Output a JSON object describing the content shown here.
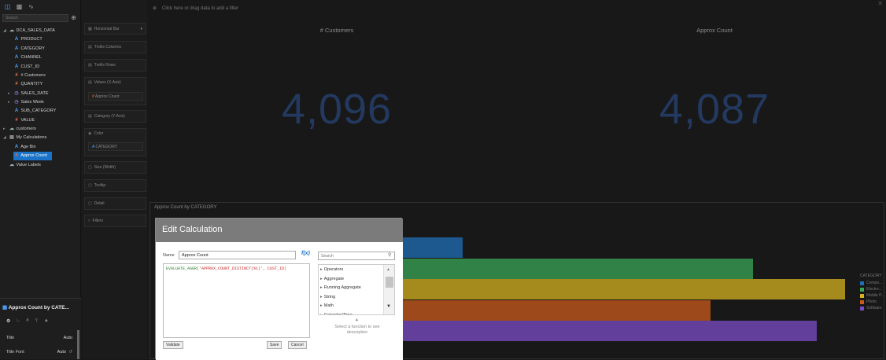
{
  "left_panel": {
    "tabs": [
      {
        "icon": "database-icon"
      },
      {
        "icon": "bar-chart-icon"
      },
      {
        "icon": "analytics-icon"
      }
    ],
    "search_placeholder": "Search",
    "tree": [
      {
        "label": "DCA_SALES_DATA",
        "type": "datasource",
        "expanded": true
      },
      {
        "label": "PRODUCT",
        "type": "attribute"
      },
      {
        "label": "CATEGORY",
        "type": "attribute"
      },
      {
        "label": "CHANNEL",
        "type": "attribute"
      },
      {
        "label": "CUST_ID",
        "type": "attribute"
      },
      {
        "label": "# Customers",
        "type": "measure"
      },
      {
        "label": "QUANTITY",
        "type": "measure"
      },
      {
        "label": "SALES_DATE",
        "type": "time"
      },
      {
        "label": "Sales Week",
        "type": "time"
      },
      {
        "label": "SUB_CATEGORY",
        "type": "attribute"
      },
      {
        "label": "VALUE",
        "type": "measure"
      },
      {
        "label": "customers",
        "type": "datasource"
      },
      {
        "label": "My Calculations",
        "type": "folder",
        "expanded": true
      },
      {
        "label": "Age Bin",
        "type": "attribute"
      },
      {
        "label": "Approx Count",
        "type": "measure",
        "selected": true
      },
      {
        "label": "Value Labels",
        "type": "datasource"
      }
    ]
  },
  "properties": {
    "title": "Approx Count by CATE...",
    "rows": [
      {
        "label": "Title",
        "value": "Auto"
      },
      {
        "label": "Title Font",
        "value": "Auto"
      }
    ]
  },
  "grammar": {
    "chart_type": "Horizontal Bar",
    "shelves": [
      {
        "label": "Trellis Columns"
      },
      {
        "label": "Trellis Rows"
      },
      {
        "label": "Values (X-Axis)"
      },
      {
        "label": "Approx Count"
      },
      {
        "label": "Category (Y-Axis)"
      },
      {
        "label": "Color"
      },
      {
        "label": "CATEGORY"
      },
      {
        "label": "Size (Width)"
      },
      {
        "label": "Tooltip"
      },
      {
        "label": "Detail"
      },
      {
        "label": "Filters"
      }
    ]
  },
  "canvas": {
    "filter_prompt": "Click here or drag data to add a filter",
    "tiles": [
      {
        "title": "# Customers",
        "value": "4,096"
      },
      {
        "title": "Approx Count",
        "value": "4,087"
      }
    ],
    "bar_chart_title": "Approx Count by CATEGORY",
    "legend_title": "CATEGORY",
    "legend": [
      {
        "label": "Compo...",
        "color": "#1f6fb5"
      },
      {
        "label": "Electro...",
        "color": "#3aa655"
      },
      {
        "label": "Mobile P...",
        "color": "#d4b21f"
      },
      {
        "label": "Photo",
        "color": "#c95a1c"
      },
      {
        "label": "Software",
        "color": "#7a4cc7"
      }
    ],
    "bars": [
      {
        "fraction": 0.43,
        "color": "#1f6fb5"
      },
      {
        "fraction": 0.84,
        "color": "#3aa655"
      },
      {
        "fraction": 0.97,
        "color": "#d4b21f"
      },
      {
        "fraction": 0.78,
        "color": "#c95a1c"
      },
      {
        "fraction": 0.93,
        "color": "#7a4cc7"
      }
    ]
  },
  "dialog": {
    "title": "Edit Calculation",
    "name_label": "Name",
    "name_value": "Approx Count",
    "fx_label": "f(x)",
    "expression_fn": "EVALUATE_AGGR(",
    "expression_arg": "'APPROX_COUNT_DISTINCT(%1)'",
    "expression_rest": ", CUST_ID)",
    "validate_label": "Validate",
    "save_label": "Save",
    "cancel_label": "Cancel",
    "function_search_placeholder": "Search",
    "function_groups": [
      "Operators",
      "Aggregate",
      "Running Aggregate",
      "String",
      "Math",
      "Calendar/Time"
    ],
    "description": "Select a function to see description"
  }
}
